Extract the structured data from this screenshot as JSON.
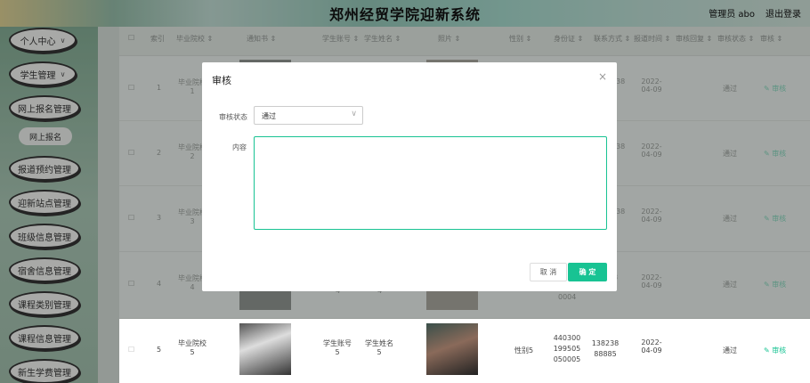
{
  "header": {
    "title": "郑州经贸学院迎新系统",
    "admin": "管理员 abo",
    "logout": "退出登录"
  },
  "sidebar": {
    "items": [
      {
        "label": "个人中心",
        "chevron": "∨"
      },
      {
        "label": "学生管理",
        "chevron": "∨"
      },
      {
        "label": "网上报名管理",
        "sub": "网上报名"
      },
      {
        "label": "报道预约管理"
      },
      {
        "label": "迎新站点管理"
      },
      {
        "label": "班级信息管理"
      },
      {
        "label": "宿舍信息管理"
      },
      {
        "label": "课程类别管理"
      },
      {
        "label": "课程信息管理"
      },
      {
        "label": "新生学费管理"
      }
    ]
  },
  "table": {
    "headers": [
      "索引",
      "毕业院校 ⇕",
      "通知书 ⇕",
      "学生账号 ⇕",
      "学生姓名 ⇕",
      "照片 ⇕",
      "性别 ⇕",
      "身份证 ⇕",
      "联系方式 ⇕",
      "报道时间 ⇕",
      "审核回复 ⇕",
      "审核状态 ⇕",
      "审核 ⇕"
    ],
    "rows": [
      {
        "index": "1",
        "school": "毕业院校1",
        "tail": "38",
        "date": "2022-04-09",
        "status": "通过",
        "action": "✎ 审核"
      },
      {
        "index": "2",
        "school": "毕业院校2",
        "tail": "38",
        "date": "2022-04-09",
        "status": "通过",
        "action": "✎ 审核"
      },
      {
        "index": "3",
        "school": "毕业院校3",
        "tail": "38",
        "date": "2022-04-09",
        "status": "通过",
        "action": "✎ 审核"
      },
      {
        "index": "4",
        "school": "毕业院校4",
        "account": "4",
        "name": "4",
        "idtail": "0004",
        "phonetail": "8",
        "date": "2022-04-09",
        "status": "通过",
        "action": "✎ 审核"
      },
      {
        "index": "5",
        "school": "毕业院校5",
        "account": "学生账号5",
        "name": "学生姓名5",
        "gender": "性别5",
        "id": "440300199505050005",
        "phone": "13823888885",
        "date": "2022-04-09",
        "status": "通过",
        "action": "✎ 审核"
      }
    ]
  },
  "dialog": {
    "title": "审核",
    "close": "×",
    "status_label": "审核状态",
    "status_value": "通过",
    "content_label": "内容",
    "content_value": "",
    "cancel": "取 消",
    "ok": "确 定",
    "select_arrow": "∨"
  }
}
